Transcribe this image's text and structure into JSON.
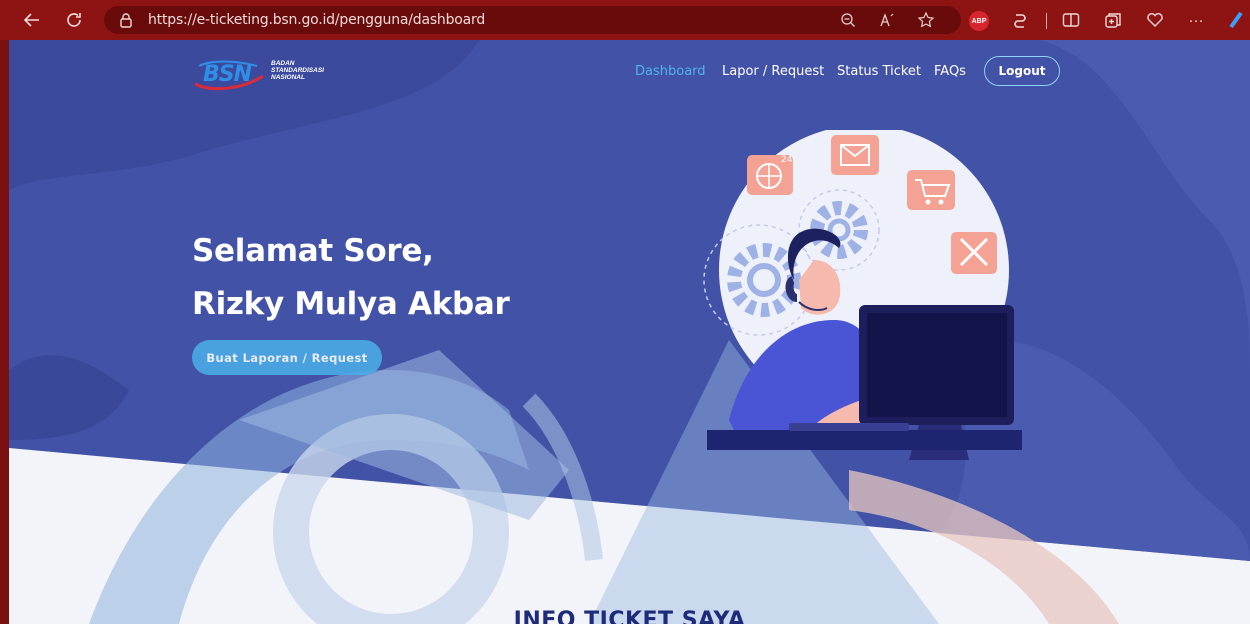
{
  "browser": {
    "url": "https://e-ticketing.bsn.go.id/pengguna/dashboard",
    "toolbar_icons": [
      "back-icon",
      "refresh-icon",
      "lock-icon",
      "zoom-out-icon",
      "read-aloud-icon",
      "favorite-star-icon",
      "adblock-plus-icon",
      "copilot-icon",
      "split-screen-icon",
      "collections-icon",
      "browser-essentials-icon",
      "more-icon",
      "edge-icon"
    ],
    "abp_label": "ABP",
    "more_label": "···"
  },
  "logo": {
    "short": "BSN",
    "name_lines": [
      "BADAN",
      "STANDARDISASI",
      "NASIONAL"
    ]
  },
  "nav": {
    "items": [
      {
        "label": "Dashboard",
        "active": true
      },
      {
        "label": "Lapor / Request",
        "active": false
      },
      {
        "label": "Status Ticket",
        "active": false
      },
      {
        "label": "FAQs",
        "active": false
      }
    ],
    "logout_label": "Logout"
  },
  "hero": {
    "greeting_line1": "Selamat Sore,",
    "greeting_line2": "Rizky Mulya Akbar",
    "cta_label": "Buat Laporan / Request"
  },
  "section": {
    "title": "INFO TICKET SAYA"
  },
  "colors": {
    "browser_frame": "#8e1414",
    "hero_background": "#4252a6",
    "nav_active": "#4fb4ee",
    "cta": "#4aaee7",
    "section_title": "#1d2b7a"
  }
}
